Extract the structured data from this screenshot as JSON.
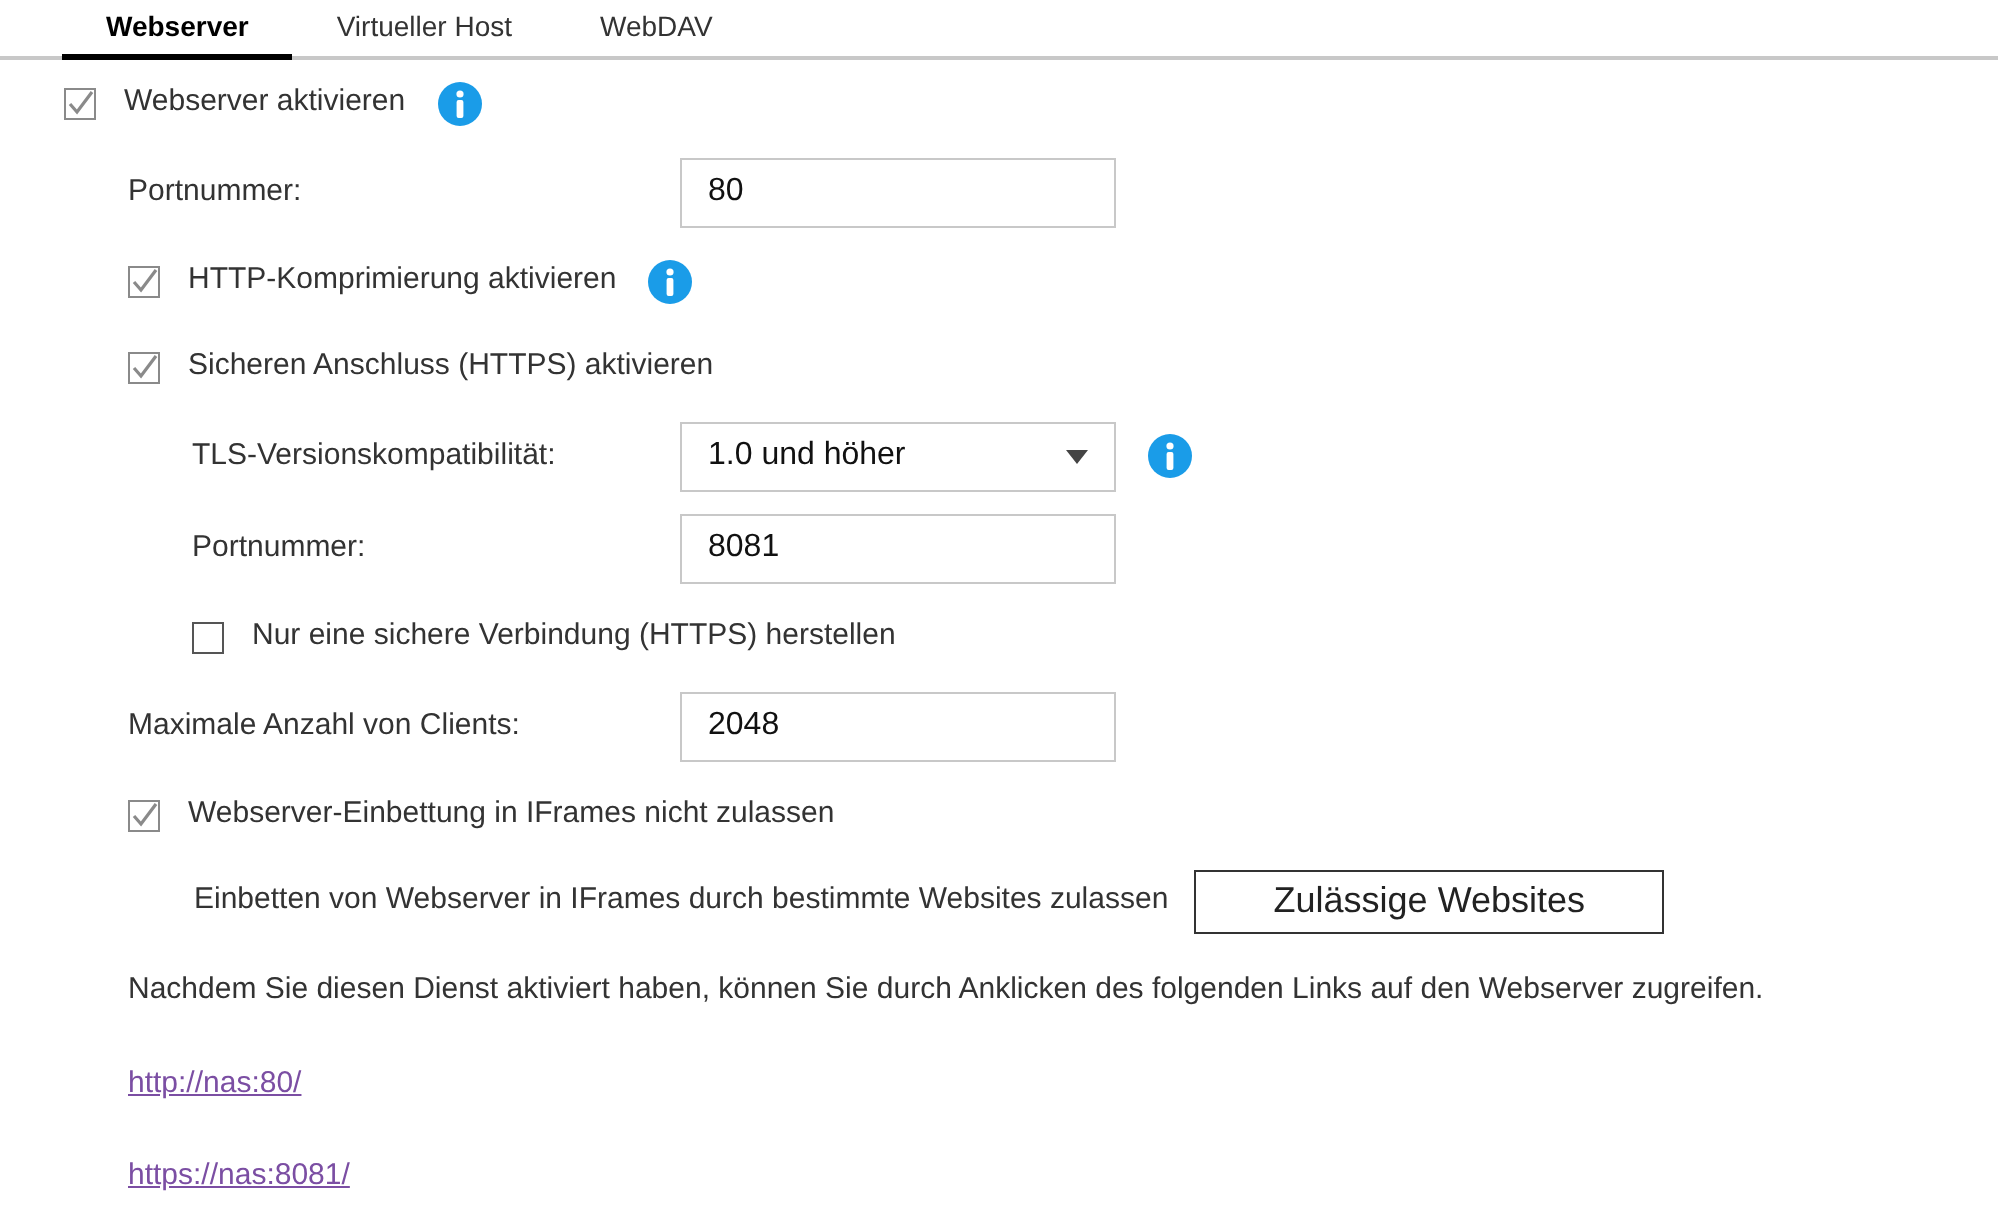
{
  "tabs": [
    {
      "label": "Webserver",
      "selected": true
    },
    {
      "label": "Virtueller Host",
      "selected": false
    },
    {
      "label": "WebDAV",
      "selected": false
    }
  ],
  "settings": [
    {
      "kind": "checkbox",
      "label": "Webserver aktivieren",
      "checked": true,
      "info": true,
      "children": [
        {
          "kind": "field",
          "label": "Portnummer:",
          "value": "80"
        },
        {
          "kind": "checkbox",
          "label": "HTTP-Komprimierung aktivieren",
          "checked": true,
          "info": true
        },
        {
          "kind": "checkbox",
          "label": "Sicheren Anschluss (HTTPS) aktivieren",
          "checked": true,
          "info": false,
          "children": [
            {
              "kind": "select",
              "label": "TLS-Versionskompatibilität:",
              "value": "1.0 und höher",
              "info": true
            },
            {
              "kind": "field",
              "label": "Portnummer:",
              "value": "8081"
            },
            {
              "kind": "checkbox",
              "label": "Nur eine sichere Verbindung (HTTPS) herstellen",
              "checked": false,
              "info": false
            }
          ]
        },
        {
          "kind": "field",
          "label": "Maximale Anzahl von Clients:",
          "value": "2048"
        },
        {
          "kind": "checkbox",
          "label": "Webserver-Einbettung in IFrames nicht zulassen",
          "checked": true,
          "info": false,
          "children": [
            {
              "kind": "action",
              "label": "Einbetten von Webserver in IFrames durch bestimmte Websites zulassen",
              "button": "Zulässige Websites"
            }
          ]
        }
      ]
    }
  ],
  "note": "Nachdem Sie diesen Dienst aktiviert haben, können Sie durch Anklicken des folgenden Links auf den Webserver zugreifen.",
  "links": [
    "http://nas:80/",
    "https://nas:8081/"
  ]
}
